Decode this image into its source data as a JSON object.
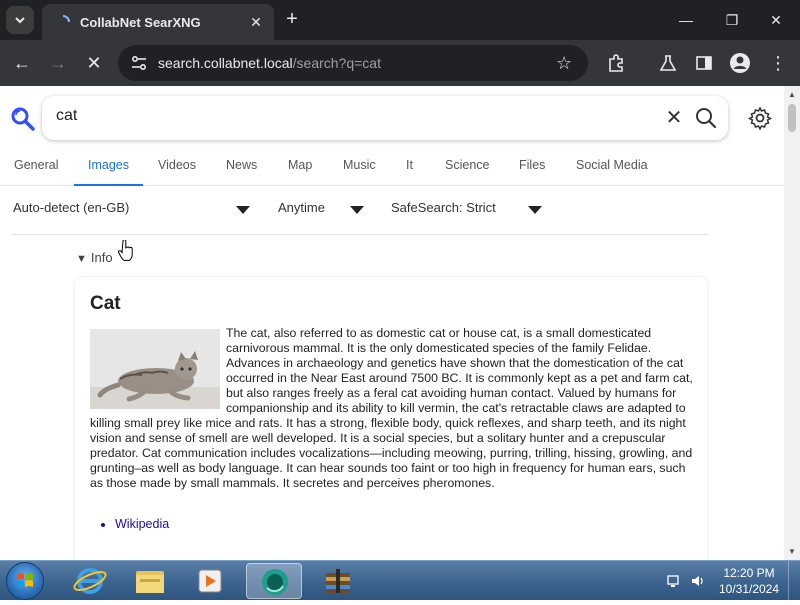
{
  "browser": {
    "tab_title": "CollabNet SearXNG",
    "url_host": "search.collabnet.local",
    "url_path": "/search?q=cat"
  },
  "search": {
    "query": "cat"
  },
  "categories": [
    {
      "label": "General",
      "active": false
    },
    {
      "label": "Images",
      "active": true
    },
    {
      "label": "Videos",
      "active": false
    },
    {
      "label": "News",
      "active": false
    },
    {
      "label": "Map",
      "active": false
    },
    {
      "label": "Music",
      "active": false
    },
    {
      "label": "It",
      "active": false
    },
    {
      "label": "Science",
      "active": false
    },
    {
      "label": "Files",
      "active": false
    },
    {
      "label": "Social Media",
      "active": false
    }
  ],
  "filters": {
    "language": "Auto-detect (en-GB)",
    "time_range": "Anytime",
    "safesearch": "SafeSearch: Strict"
  },
  "info": {
    "summary_label": "Info",
    "title": "Cat",
    "text": "The cat, also referred to as domestic cat or house cat, is a small domesticated carnivorous mammal. It is the only domesticated species of the family Felidae. Advances in archaeology and genetics have shown that the domestication of the cat occurred in the Near East around 7500 BC. It is commonly kept as a pet and farm cat, but also ranges freely as a feral cat avoiding human contact. Valued by humans for companionship and its ability to kill vermin, the cat's retractable claws are adapted to killing small prey like mice and rats. It has a strong, flexible body, quick reflexes, and sharp teeth, and its night vision and sense of smell are well developed. It is a social species, but a solitary hunter and a crepuscular predator. Cat communication includes vocalizations—including meowing, purring, trilling, hissing, growling, and grunting–as well as body language. It can hear sounds too faint or too high in frequency for human ears, such as those made by small mammals. It secretes and perceives pheromones.",
    "links": [
      "Wikipedia"
    ]
  },
  "taskbar": {
    "time": "12:20 PM",
    "date": "10/31/2024"
  },
  "colors": {
    "accent": "#1a73e8",
    "chrome_dark": "#202124",
    "link": "#1a0dab"
  }
}
